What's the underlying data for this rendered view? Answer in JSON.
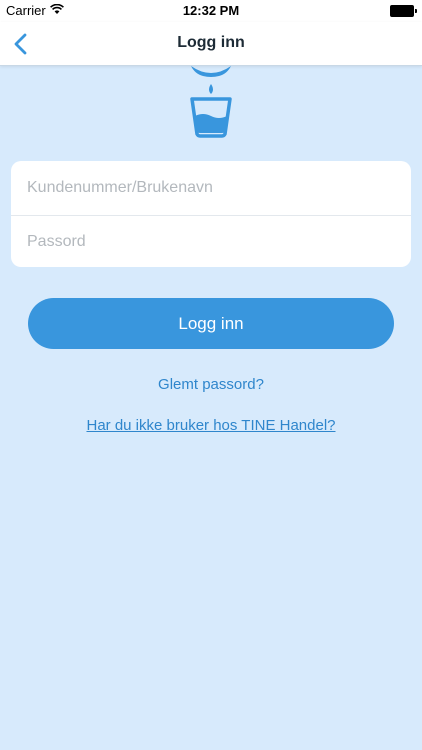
{
  "status_bar": {
    "carrier": "Carrier",
    "time": "12:32 PM"
  },
  "nav": {
    "title": "Logg inn"
  },
  "form": {
    "username_placeholder": "Kundenummer/Brukenavn",
    "username_value": "",
    "password_placeholder": "Passord",
    "password_value": ""
  },
  "actions": {
    "login_label": "Logg inn",
    "forgot_password_label": "Glemt passord?",
    "register_label": "Har du ikke bruker hos TINE Handel?"
  },
  "colors": {
    "background": "#d7eafc",
    "accent": "#3996dd",
    "link": "#2f86cc"
  },
  "icons": {
    "back": "chevron-left-icon",
    "wifi": "wifi-icon",
    "battery": "battery-icon",
    "logo": "milk-glass-logo"
  }
}
